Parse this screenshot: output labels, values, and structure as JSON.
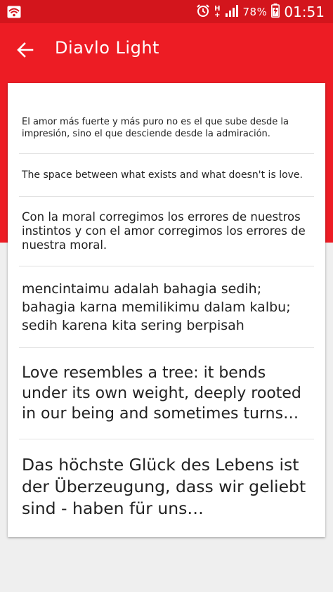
{
  "status_bar": {
    "network_top": "H",
    "network_bottom": "+",
    "battery_percent": "78%",
    "time": "01:51",
    "icons": [
      "wifi-icon",
      "alarm-icon",
      "signal-icon",
      "battery-icon"
    ]
  },
  "app_bar": {
    "title": "Diavlo Light",
    "back_icon": "back-arrow-icon"
  },
  "samples": [
    {
      "text": "El amor más fuerte y más puro no es el que sube desde la impresión, sino el que desciende desde la admiración."
    },
    {
      "text": "The space between what exists and what doesn't is love."
    },
    {
      "text": "Con la moral corregimos los errores de nuestros instintos y con el amor corregimos los errores de nuestra moral."
    },
    {
      "text": "mencintaimu adalah bahagia sedih; bahagia karna memilikimu dalam kalbu; sedih karena kita sering berpisah"
    },
    {
      "text": "Love resembles a tree: it bends under its own weight, deeply rooted in our being and sometimes turns…"
    },
    {
      "text": "Das höchste Glück des Lebens ist der Überzeugung, dass wir geliebt sind - haben für uns…"
    }
  ],
  "colors": {
    "status_bar": "#d3151c",
    "accent": "#ed1c24",
    "background": "#efefef",
    "card": "#ffffff"
  }
}
